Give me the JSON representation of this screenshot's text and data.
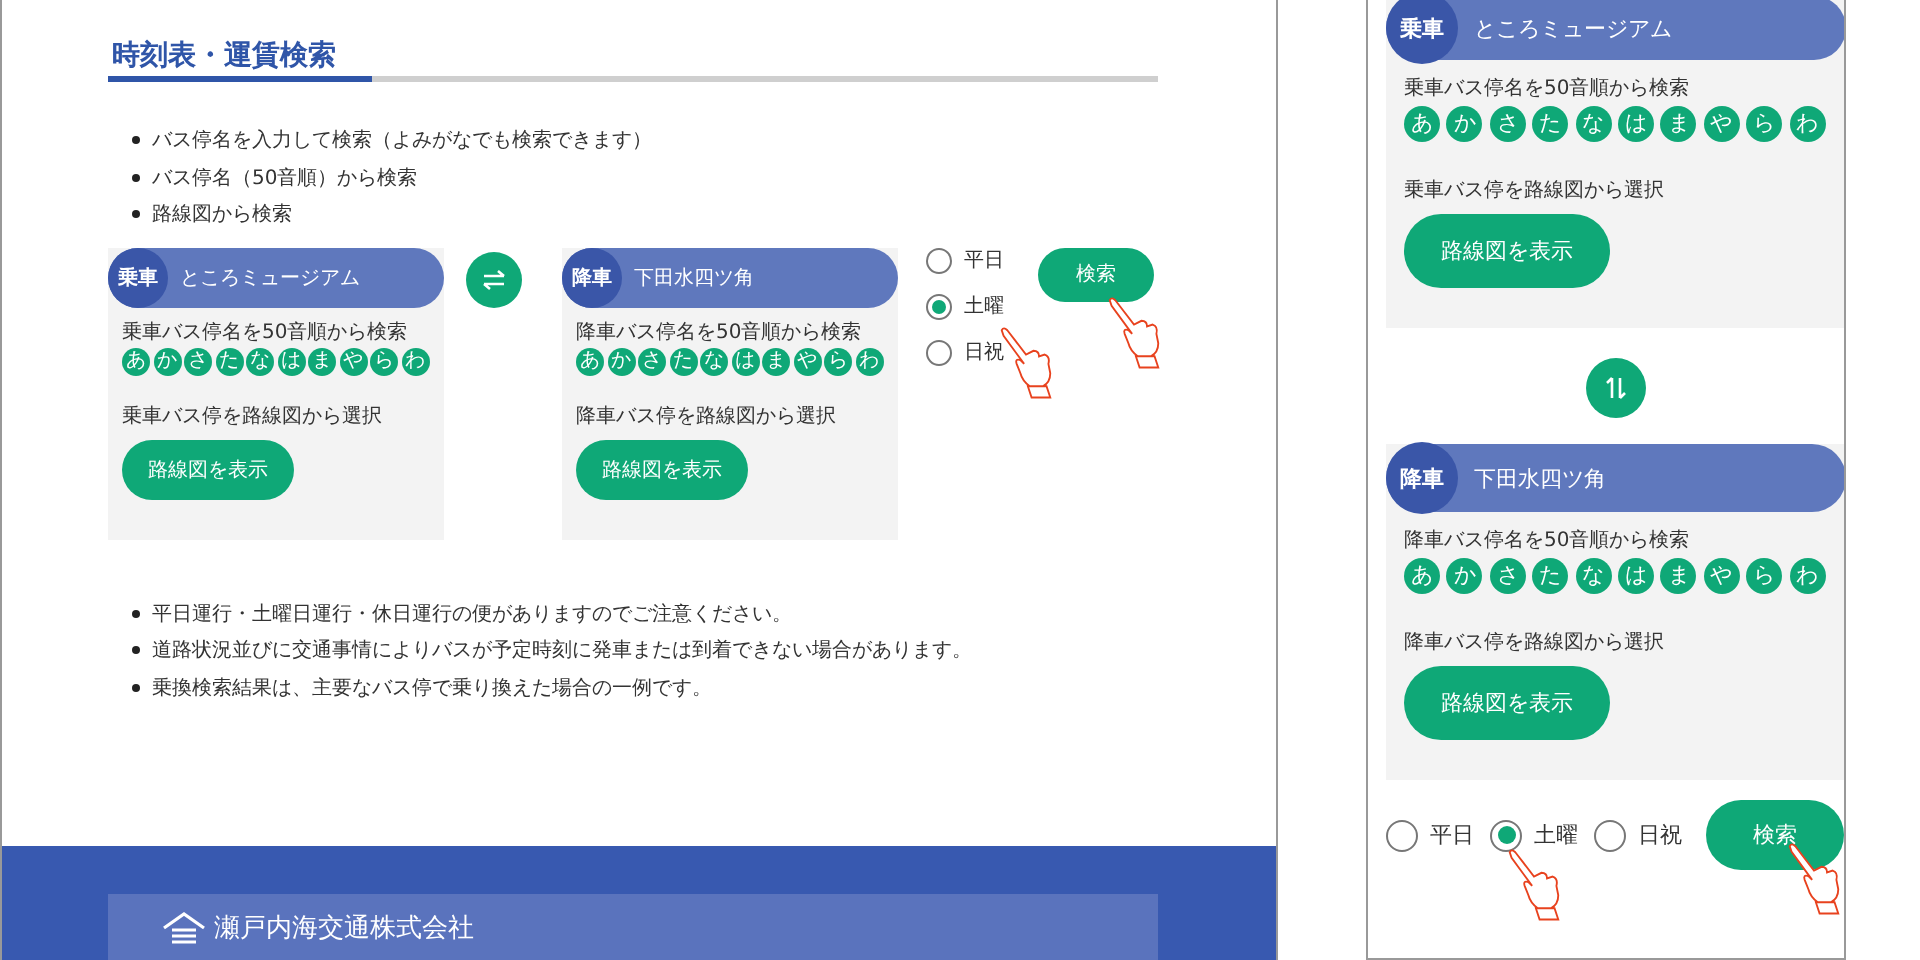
{
  "desktop_view": {
    "title": "時刻表・運賃検索",
    "search_methods": [
      "バス停名を入力して検索（よみがなでも検索できます）",
      "バス停名（50音順）から検索",
      "路線図から検索"
    ],
    "cards": [
      {
        "badge": "乗車",
        "stop": "ところミュージアム",
        "kana_label": "乗車バス停名を50音順から検索",
        "kana": [
          "あ",
          "か",
          "さ",
          "た",
          "な",
          "は",
          "ま",
          "や",
          "ら",
          "わ"
        ],
        "map_label": "乗車バス停を路線図から選択",
        "map_button": "路線図を表示"
      },
      {
        "badge": "降車",
        "stop": "下田水四ツ角",
        "kana_label": "降車バス停名を50音順から検索",
        "kana": [
          "あ",
          "か",
          "さ",
          "た",
          "な",
          "は",
          "ま",
          "や",
          "ら",
          "わ"
        ],
        "map_label": "降車バス停を路線図から選択",
        "map_button": "路線図を表示"
      }
    ],
    "day_options": [
      {
        "label": "平日",
        "selected": false
      },
      {
        "label": "土曜",
        "selected": true
      },
      {
        "label": "日祝",
        "selected": false
      }
    ],
    "search_button": "検索",
    "notes": [
      "平日運行・土曜日運行・休日運行の便がありますのでご注意ください。",
      "道路状況並びに交通事情によりバスが予定時刻に発車または到着できない場合があります。",
      "乗換検索結果は、主要なバス停で乗り換えた場合の一例です。"
    ],
    "footer": {
      "company": "瀬戸内海交通株式会社"
    }
  },
  "mobile_view": {
    "cards": [
      {
        "badge": "乗車",
        "stop": "ところミュージアム",
        "kana_label": "乗車バス停名を50音順から検索",
        "kana": [
          "あ",
          "か",
          "さ",
          "た",
          "な",
          "は",
          "ま",
          "や",
          "ら",
          "わ"
        ],
        "map_label": "乗車バス停を路線図から選択",
        "map_button": "路線図を表示"
      },
      {
        "badge": "降車",
        "stop": "下田水四ツ角",
        "kana_label": "降車バス停名を50音順から検索",
        "kana": [
          "あ",
          "か",
          "さ",
          "た",
          "な",
          "は",
          "ま",
          "や",
          "ら",
          "わ"
        ],
        "map_label": "降車バス停を路線図から選択",
        "map_button": "路線図を表示"
      }
    ],
    "day_options": [
      {
        "label": "平日",
        "selected": false
      },
      {
        "label": "土曜",
        "selected": true
      },
      {
        "label": "日祝",
        "selected": false
      }
    ],
    "search_button": "検索"
  }
}
